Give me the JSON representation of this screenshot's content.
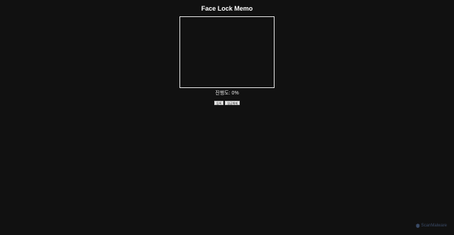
{
  "app": {
    "title": "Face Lock Memo"
  },
  "camera": {
    "label": ""
  },
  "progress": {
    "label": "진행도:",
    "value": "0%"
  },
  "buttons": [
    {
      "label": "등록"
    },
    {
      "label": "잠금해제"
    }
  ],
  "watermark": {
    "text": "ScanMalware",
    "icon": "scanmalware-logo-icon"
  },
  "colors": {
    "background": "#111111",
    "text": "#ffffff",
    "border": "#e6e6e6",
    "watermark": "#3a4a66"
  }
}
